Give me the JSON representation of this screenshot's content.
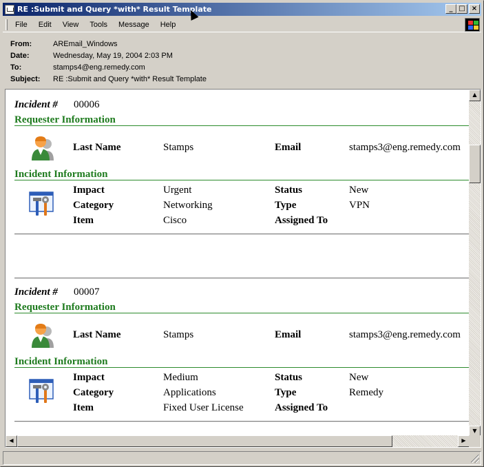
{
  "window": {
    "title": "RE :Submit and Query *with* Result Template",
    "controls": [
      "minimize",
      "maximize",
      "close"
    ]
  },
  "menu": [
    "File",
    "Edit",
    "View",
    "Tools",
    "Message",
    "Help"
  ],
  "headers": [
    {
      "label": "From:",
      "value": "AREmail_Windows"
    },
    {
      "label": "Date:",
      "value": "Wednesday, May 19, 2004 2:03 PM"
    },
    {
      "label": "To:",
      "value": "stamps4@eng.remedy.com"
    },
    {
      "label": "Subject:",
      "value": "RE :Submit and Query *with* Result Template"
    }
  ],
  "incidents": [
    {
      "incident_label": "Incident #",
      "incident_number": "00006",
      "requester_title": "Requester Information",
      "last_name_label": "Last Name",
      "last_name": "Stamps",
      "email_label": "Email",
      "email": "stamps3@eng.remedy.com",
      "incident_info_title": "Incident Information",
      "impact_label": "Impact",
      "impact": "Urgent",
      "status_label": "Status",
      "status": "New",
      "category_label": "Category",
      "category": "Networking",
      "type_label": "Type",
      "type": "VPN",
      "item_label": "Item",
      "item": "Cisco",
      "assigned_label": "Assigned To",
      "assigned": ""
    },
    {
      "incident_label": "Incident #",
      "incident_number": "00007",
      "requester_title": "Requester Information",
      "last_name_label": "Last Name",
      "last_name": "Stamps",
      "email_label": "Email",
      "email": "stamps3@eng.remedy.com",
      "incident_info_title": "Incident Information",
      "impact_label": "Impact",
      "impact": "Medium",
      "status_label": "Status",
      "status": "New",
      "category_label": "Category",
      "category": "Applications",
      "type_label": "Type",
      "type": "Remedy",
      "item_label": "Item",
      "item": "Fixed User License",
      "assigned_label": "Assigned To",
      "assigned": ""
    }
  ],
  "icons": {
    "title": "envelope-icon",
    "requester": "person-icon",
    "incident": "tools-icon",
    "windows": "windows-logo-icon"
  },
  "colors": {
    "section_title": "#1e7b1e",
    "titlebar_start": "#0a246a",
    "titlebar_end": "#a6caf0"
  }
}
